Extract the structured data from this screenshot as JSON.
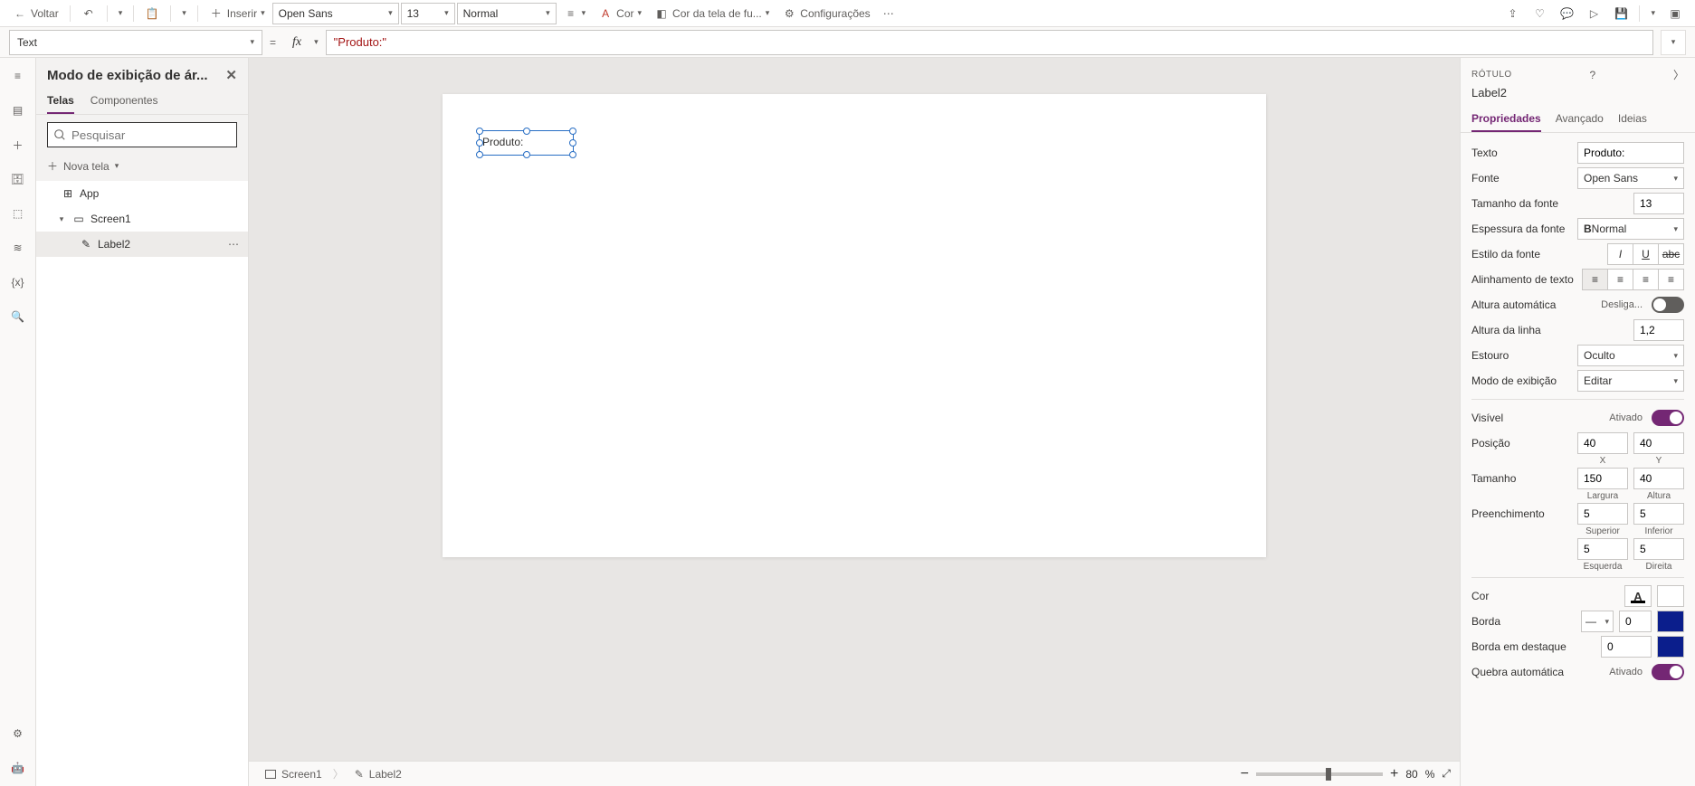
{
  "toolbar": {
    "back": "Voltar",
    "insert": "Inserir",
    "font": "Open Sans",
    "size": "13",
    "weight": "Normal",
    "color": "Cor",
    "bgcolor": "Cor da tela de fu...",
    "settings": "Configurações"
  },
  "formula": {
    "property": "Text",
    "fx": "fx",
    "value": "\"Produto:\""
  },
  "tree": {
    "title": "Modo de exibição de ár...",
    "tab_screens": "Telas",
    "tab_components": "Componentes",
    "search_ph": "Pesquisar",
    "new_screen": "Nova tela",
    "app": "App",
    "screen1": "Screen1",
    "label2": "Label2"
  },
  "canvas": {
    "label_text": "Produto:"
  },
  "status": {
    "screen": "Screen1",
    "label": "Label2",
    "zoom": "80",
    "zoom_pct": "%"
  },
  "right": {
    "kind": "RÓTULO",
    "name": "Label2",
    "tab_props": "Propriedades",
    "tab_adv": "Avançado",
    "tab_ideas": "Ideias",
    "p_text": "Texto",
    "v_text": "Produto:",
    "p_font": "Fonte",
    "v_font": "Open Sans",
    "p_size": "Tamanho da fonte",
    "v_size": "13",
    "p_weight": "Espessura da fonte",
    "v_weight": "Normal",
    "p_style": "Estilo da fonte",
    "p_align": "Alinhamento de texto",
    "p_autoh": "Altura automática",
    "v_autoh": "Desliga...",
    "p_lineh": "Altura da linha",
    "v_lineh": "1,2",
    "p_overflow": "Estouro",
    "v_overflow": "Oculto",
    "p_dispmode": "Modo de exibição",
    "v_dispmode": "Editar",
    "p_visible": "Visível",
    "v_visible": "Ativado",
    "p_pos": "Posição",
    "v_x": "40",
    "v_y": "40",
    "sub_x": "X",
    "sub_y": "Y",
    "p_sizep": "Tamanho",
    "v_w": "150",
    "v_h": "40",
    "sub_w": "Largura",
    "sub_h": "Altura",
    "p_pad": "Preenchimento",
    "v_ptop": "5",
    "v_pbot": "5",
    "v_pleft": "5",
    "v_pright": "5",
    "sub_top": "Superior",
    "sub_bot": "Inferior",
    "sub_left": "Esquerda",
    "sub_right": "Direita",
    "p_color": "Cor",
    "p_border": "Borda",
    "v_border": "0",
    "p_fborder": "Borda em destaque",
    "v_fborder": "0",
    "p_wrap": "Quebra automática",
    "v_wrap": "Ativado"
  }
}
